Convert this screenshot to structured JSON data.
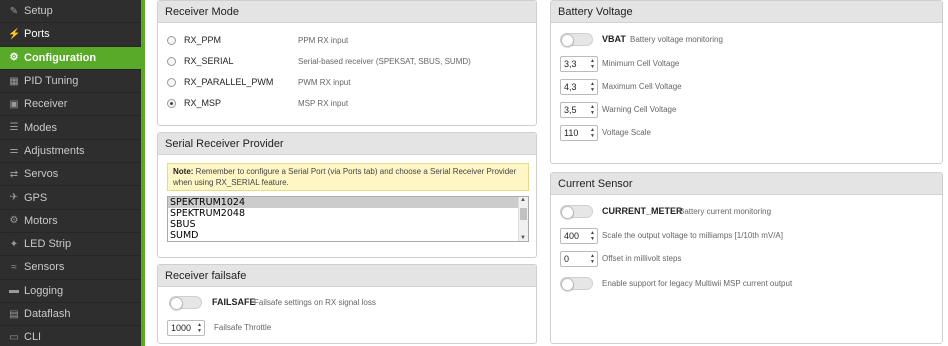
{
  "sidebar": {
    "items": [
      {
        "label": "Setup",
        "icon": "wrench-icon",
        "glyph": "✎"
      },
      {
        "label": "Ports",
        "icon": "plug-icon",
        "glyph": "⚡"
      },
      {
        "label": "Configuration",
        "icon": "gear-icon",
        "glyph": "⚙"
      },
      {
        "label": "PID Tuning",
        "icon": "grid-icon",
        "glyph": "▦"
      },
      {
        "label": "Receiver",
        "icon": "receiver-icon",
        "glyph": "▣"
      },
      {
        "label": "Modes",
        "icon": "modes-icon",
        "glyph": "☰"
      },
      {
        "label": "Adjustments",
        "icon": "sliders-icon",
        "glyph": "⚌"
      },
      {
        "label": "Servos",
        "icon": "servo-icon",
        "glyph": "⇄"
      },
      {
        "label": "GPS",
        "icon": "satellite-icon",
        "glyph": "✈"
      },
      {
        "label": "Motors",
        "icon": "motor-icon",
        "glyph": "⚙"
      },
      {
        "label": "LED Strip",
        "icon": "led-icon",
        "glyph": "✦"
      },
      {
        "label": "Sensors",
        "icon": "sensors-icon",
        "glyph": "≈"
      },
      {
        "label": "Logging",
        "icon": "logging-icon",
        "glyph": "▬"
      },
      {
        "label": "Dataflash",
        "icon": "dataflash-icon",
        "glyph": "▤"
      },
      {
        "label": "CLI",
        "icon": "cli-icon",
        "glyph": "▭"
      }
    ]
  },
  "receiver_mode": {
    "title": "Receiver Mode",
    "options": [
      {
        "name": "RX_PPM",
        "desc": "PPM RX input",
        "checked": false
      },
      {
        "name": "RX_SERIAL",
        "desc": "Serial-based receiver (SPEKSAT, SBUS, SUMD)",
        "checked": false
      },
      {
        "name": "RX_PARALLEL_PWM",
        "desc": "PWM RX input",
        "checked": false
      },
      {
        "name": "RX_MSP",
        "desc": "MSP RX input",
        "checked": true
      }
    ]
  },
  "serial_provider": {
    "title": "Serial Receiver Provider",
    "note_bold": "Note:",
    "note_text": " Remember to configure a Serial Port (via Ports tab) and choose a Serial Receiver Provider when using RX_SERIAL feature.",
    "options": [
      "SPEKTRUM1024",
      "SPEKTRUM2048",
      "SBUS",
      "SUMD"
    ],
    "selected": "SPEKTRUM1024"
  },
  "failsafe": {
    "title": "Receiver failsafe",
    "toggle_label": "FAILSAFE",
    "toggle_desc": "Failsafe settings on RX signal loss",
    "throttle_value": "1000",
    "throttle_label": "Failsafe Throttle"
  },
  "battery": {
    "title": "Battery Voltage",
    "toggle_label": "VBAT",
    "toggle_desc": "Battery voltage monitoring",
    "fields": [
      {
        "value": "3,3",
        "label": "Minimum Cell Voltage"
      },
      {
        "value": "4,3",
        "label": "Maximum Cell Voltage"
      },
      {
        "value": "3,5",
        "label": "Warning Cell Voltage"
      },
      {
        "value": "110",
        "label": "Voltage Scale"
      }
    ]
  },
  "current": {
    "title": "Current Sensor",
    "toggle_label": "CURRENT_METER",
    "toggle_desc": "Battery current monitoring",
    "fields": [
      {
        "value": "400",
        "label": "Scale the output voltage to milliamps [1/10th mV/A]"
      },
      {
        "value": "0",
        "label": "Offset in millivolt steps"
      }
    ],
    "legacy_label": "Enable support for legacy Multiwii MSP current output"
  },
  "colors": {
    "accent": "#59aa29",
    "sidebar_bg": "#2e2e2e"
  }
}
